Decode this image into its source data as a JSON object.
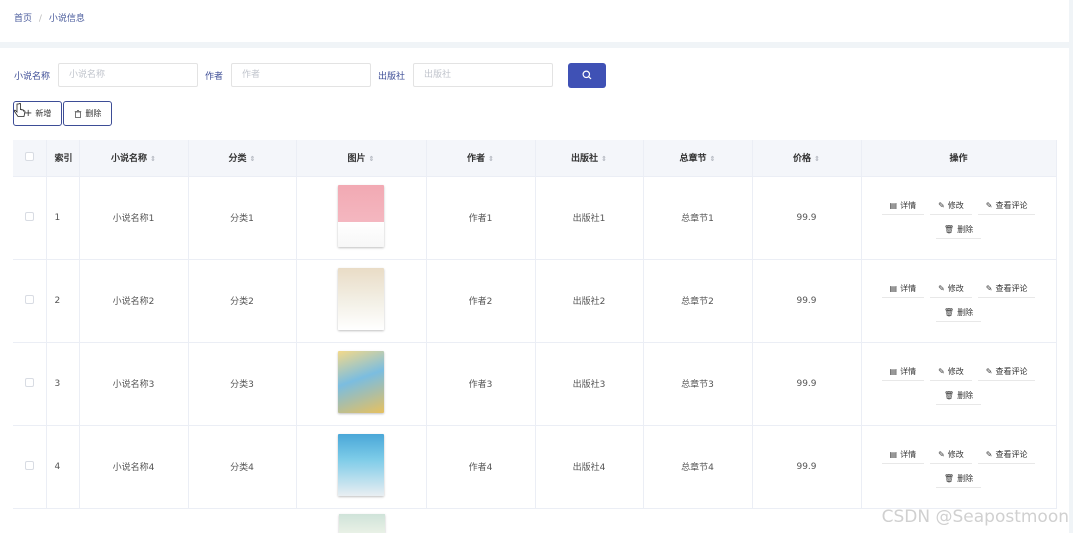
{
  "breadcrumb": {
    "home": "首页",
    "sep": "/",
    "current": "小说信息"
  },
  "search": {
    "name_label": "小说名称",
    "name_placeholder": "小说名称",
    "author_label": "作者",
    "author_placeholder": "作者",
    "publisher_label": "出版社",
    "publisher_placeholder": "出版社"
  },
  "actions": {
    "add": "新增",
    "delete": "删除"
  },
  "table": {
    "headers": {
      "index": "索引",
      "name": "小说名称",
      "category": "分类",
      "image": "图片",
      "author": "作者",
      "publisher": "出版社",
      "chapters": "总章节",
      "price": "价格",
      "ops": "操作"
    },
    "ops": {
      "detail": "详情",
      "edit": "修改",
      "comments": "查看评论",
      "delete": "删除"
    },
    "rows": [
      {
        "index": "1",
        "name": "小说名称1",
        "category": "分类1",
        "author": "作者1",
        "publisher": "出版社1",
        "chapters": "总章节1",
        "price": "99.9"
      },
      {
        "index": "2",
        "name": "小说名称2",
        "category": "分类2",
        "author": "作者2",
        "publisher": "出版社2",
        "chapters": "总章节2",
        "price": "99.9"
      },
      {
        "index": "3",
        "name": "小说名称3",
        "category": "分类3",
        "author": "作者3",
        "publisher": "出版社3",
        "chapters": "总章节3",
        "price": "99.9"
      },
      {
        "index": "4",
        "name": "小说名称4",
        "category": "分类4",
        "author": "作者4",
        "publisher": "出版社4",
        "chapters": "总章节4",
        "price": "99.9"
      }
    ]
  },
  "watermark": "CSDN @Seapostmoon",
  "colors": {
    "accent": "#3f51b5",
    "label": "#3d4d96",
    "header_bg": "#f4f6fa"
  }
}
